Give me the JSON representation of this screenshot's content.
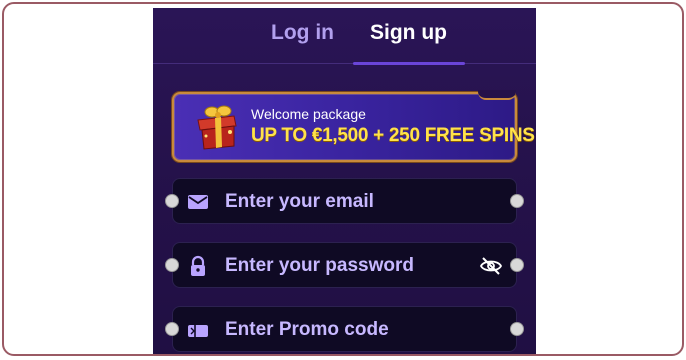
{
  "tabs": {
    "login_label": "Log in",
    "signup_label": "Sign up",
    "active": "signup"
  },
  "banner": {
    "title": "Welcome package",
    "offer": "UP TO €1,500 + 250 FREE SPINS"
  },
  "fields": {
    "email_placeholder": "Enter your email",
    "password_placeholder": "Enter your password",
    "promo_placeholder": "Enter Promo code"
  },
  "icons": {
    "email": "envelope-icon",
    "password": "lock-icon",
    "promo": "ticket-icon",
    "visibility": "eye-off-icon",
    "banner": "gift-icon"
  },
  "colors": {
    "panel_bg": "#241149",
    "field_bg": "#0f0a24",
    "accent": "#6a45d8",
    "placeholder": "#c7b8ff",
    "offer_text": "#ffe24a",
    "frame_border": "#9a5a64"
  }
}
